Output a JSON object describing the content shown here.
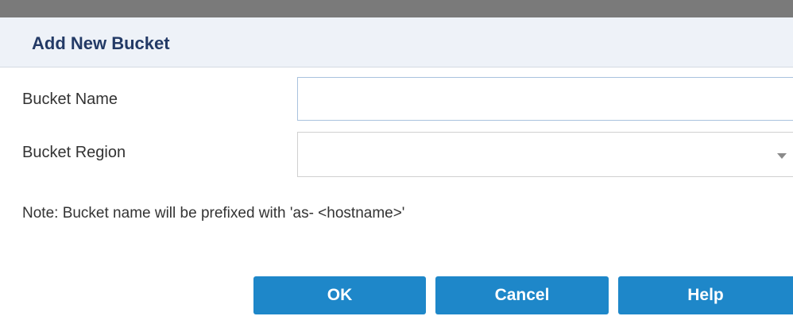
{
  "dialog": {
    "title": "Add New Bucket",
    "fields": {
      "bucket_name": {
        "label": "Bucket Name",
        "value": "",
        "placeholder": ""
      },
      "bucket_region": {
        "label": "Bucket Region",
        "selected": ""
      }
    },
    "note": "Note: Bucket name will be prefixed with 'as- <hostname>'",
    "buttons": {
      "ok": "OK",
      "cancel": "Cancel",
      "help": "Help"
    }
  },
  "icons": {
    "dropdown": "chevron-down-icon"
  },
  "colors": {
    "button_bg": "#1e87c9",
    "title_text": "#233a66",
    "header_bg": "#eef2f8",
    "top_bar": "#7a7a7a"
  }
}
